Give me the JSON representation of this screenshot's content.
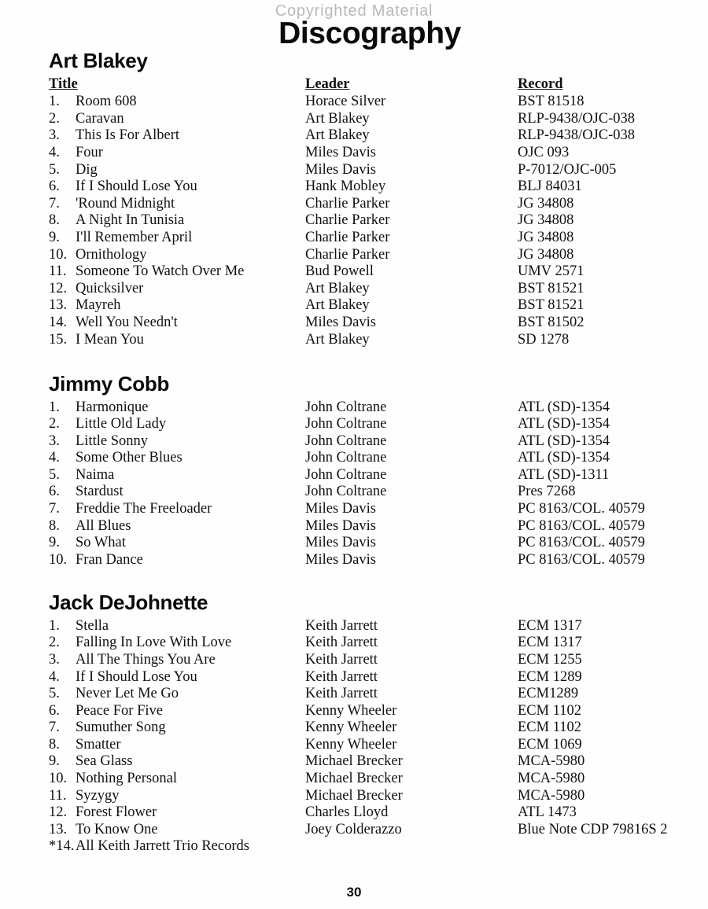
{
  "watermark": "Copyrighted Material",
  "title": "Discography",
  "page_number": "30",
  "columns": {
    "title": "Title",
    "leader": "Leader",
    "record": "Record"
  },
  "sections": [
    {
      "artist": "Art Blakey",
      "show_column_headers": true,
      "rows": [
        {
          "num": "1.",
          "title": "Room 608",
          "leader": "Horace Silver",
          "record": "BST 81518"
        },
        {
          "num": "2.",
          "title": "Caravan",
          "leader": "Art Blakey",
          "record": "RLP-9438/OJC-038"
        },
        {
          "num": "3.",
          "title": "This Is For Albert",
          "leader": "Art Blakey",
          "record": "RLP-9438/OJC-038"
        },
        {
          "num": "4.",
          "title": "Four",
          "leader": "Miles Davis",
          "record": "OJC 093"
        },
        {
          "num": "5.",
          "title": "Dig",
          "leader": "Miles Davis",
          "record": "P-7012/OJC-005"
        },
        {
          "num": "6.",
          "title": "If I Should Lose You",
          "leader": "Hank Mobley",
          "record": "BLJ 84031"
        },
        {
          "num": "7.",
          "title": "'Round Midnight",
          "leader": "Charlie Parker",
          "record": "JG 34808"
        },
        {
          "num": "8.",
          "title": "A Night In Tunisia",
          "leader": "Charlie Parker",
          "record": "JG 34808"
        },
        {
          "num": "9.",
          "title": "I'll Remember April",
          "leader": "Charlie Parker",
          "record": "JG 34808"
        },
        {
          "num": "10.",
          "title": "Ornithology",
          "leader": "Charlie Parker",
          "record": "JG 34808"
        },
        {
          "num": "11.",
          "title": "Someone To Watch Over Me",
          "leader": "Bud Powell",
          "record": "UMV 2571"
        },
        {
          "num": "12.",
          "title": "Quicksilver",
          "leader": "Art Blakey",
          "record": "BST 81521"
        },
        {
          "num": "13.",
          "title": "Mayreh",
          "leader": "Art Blakey",
          "record": "BST 81521"
        },
        {
          "num": "14.",
          "title": "Well You Needn't",
          "leader": "Miles Davis",
          "record": "BST 81502"
        },
        {
          "num": "15.",
          "title": "I Mean You",
          "leader": "Art Blakey",
          "record": "SD 1278"
        }
      ]
    },
    {
      "artist": "Jimmy Cobb",
      "show_column_headers": false,
      "rows": [
        {
          "num": "1.",
          "title": "Harmonique",
          "leader": "John Coltrane",
          "record": "ATL (SD)-1354"
        },
        {
          "num": "2.",
          "title": "Little Old Lady",
          "leader": "John Coltrane",
          "record": "ATL (SD)-1354"
        },
        {
          "num": "3.",
          "title": "Little Sonny",
          "leader": "John Coltrane",
          "record": "ATL (SD)-1354"
        },
        {
          "num": "4.",
          "title": "Some Other Blues",
          "leader": "John Coltrane",
          "record": "ATL (SD)-1354"
        },
        {
          "num": "5.",
          "title": "Naima",
          "leader": "John Coltrane",
          "record": "ATL (SD)-1311"
        },
        {
          "num": "6.",
          "title": "Stardust",
          "leader": "John Coltrane",
          "record": "Pres 7268"
        },
        {
          "num": "7.",
          "title": "Freddie The Freeloader",
          "leader": "Miles Davis",
          "record": "PC 8163/COL. 40579"
        },
        {
          "num": "8.",
          "title": "All Blues",
          "leader": "Miles Davis",
          "record": "PC 8163/COL. 40579"
        },
        {
          "num": "9.",
          "title": "So What",
          "leader": "Miles Davis",
          "record": "PC 8163/COL. 40579"
        },
        {
          "num": "10.",
          "title": "Fran Dance",
          "leader": "Miles Davis",
          "record": "PC 8163/COL. 40579"
        }
      ]
    },
    {
      "artist": "Jack DeJohnette",
      "show_column_headers": false,
      "rows": [
        {
          "num": "1.",
          "title": "Stella",
          "leader": "Keith Jarrett",
          "record": "ECM 1317"
        },
        {
          "num": "2.",
          "title": "Falling In Love With Love",
          "leader": "Keith Jarrett",
          "record": "ECM 1317"
        },
        {
          "num": "3.",
          "title": "All The Things You Are",
          "leader": "Keith Jarrett",
          "record": "ECM 1255"
        },
        {
          "num": "4.",
          "title": "If I Should Lose You",
          "leader": "Keith Jarrett",
          "record": "ECM 1289"
        },
        {
          "num": "5.",
          "title": "Never Let Me Go",
          "leader": "Keith Jarrett",
          "record": "ECM1289"
        },
        {
          "num": "6.",
          "title": "Peace For Five",
          "leader": "Kenny Wheeler",
          "record": "ECM 1102"
        },
        {
          "num": "7.",
          "title": "Sumuther Song",
          "leader": "Kenny Wheeler",
          "record": "ECM 1102"
        },
        {
          "num": "8.",
          "title": "Smatter",
          "leader": "Kenny Wheeler",
          "record": "ECM 1069"
        },
        {
          "num": "9.",
          "title": "Sea Glass",
          "leader": "Michael Brecker",
          "record": "MCA-5980"
        },
        {
          "num": "10.",
          "title": "Nothing Personal",
          "leader": "Michael Brecker",
          "record": "MCA-5980"
        },
        {
          "num": "11.",
          "title": "Syzygy",
          "leader": "Michael Brecker",
          "record": "MCA-5980"
        },
        {
          "num": "12.",
          "title": "Forest Flower",
          "leader": "Charles Lloyd",
          "record": "ATL 1473"
        },
        {
          "num": "13.",
          "title": "To Know One",
          "leader": "Joey Colderazzo",
          "record": "Blue Note CDP 79816S 2"
        },
        {
          "num": "*14.",
          "title": "All Keith Jarrett Trio Records",
          "leader": "",
          "record": ""
        }
      ]
    }
  ]
}
